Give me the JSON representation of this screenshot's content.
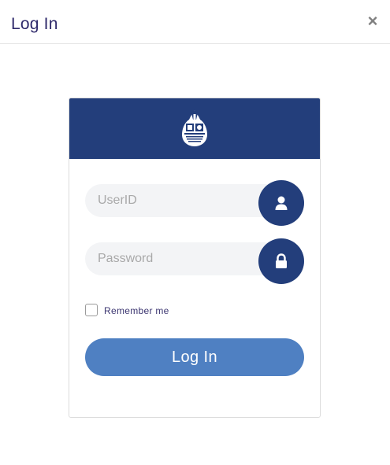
{
  "modal": {
    "title": "Log In",
    "close_label": "×"
  },
  "form": {
    "userid_placeholder": "UserID",
    "userid_value": "",
    "password_placeholder": "Password",
    "password_value": "",
    "remember_label": "Remember me",
    "remember_checked": false,
    "submit_label": "Log In"
  },
  "icons": {
    "logo": "crest-logo-icon",
    "user": "user-icon",
    "lock": "lock-icon",
    "close": "close-icon"
  },
  "colors": {
    "banner": "#233e7b",
    "button": "#4f80c2",
    "title": "#2f2a6b"
  }
}
